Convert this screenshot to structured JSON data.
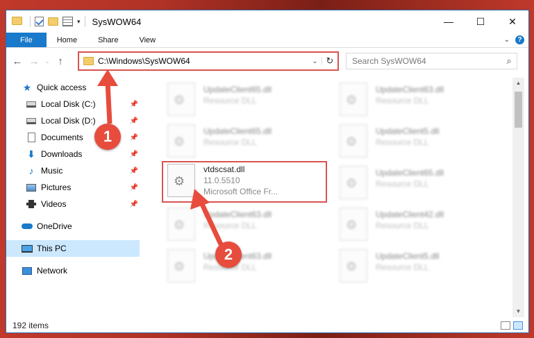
{
  "window": {
    "title": "SysWOW64",
    "controls": {
      "minimize": "—",
      "maximize": "☐",
      "close": "✕"
    }
  },
  "ribbon": {
    "tabs": [
      "File",
      "Home",
      "Share",
      "View"
    ],
    "help": "?"
  },
  "nav": {
    "back": "←",
    "forward": "→",
    "recent": "⌄",
    "up": "↑"
  },
  "address": {
    "path": "C:\\Windows\\SysWOW64",
    "dropdown": "⌄",
    "refresh": "↻"
  },
  "search": {
    "placeholder": "Search SysWOW64",
    "icon": "⌕"
  },
  "sidebar": {
    "items": [
      {
        "label": "Quick access",
        "icon": "star-icon",
        "pinned": false
      },
      {
        "label": "Local Disk (C:)",
        "icon": "disk-icon",
        "pinned": true
      },
      {
        "label": "Local Disk (D:)",
        "icon": "disk-icon",
        "pinned": true
      },
      {
        "label": "Documents",
        "icon": "documents-icon",
        "pinned": true
      },
      {
        "label": "Downloads",
        "icon": "download-icon",
        "pinned": true
      },
      {
        "label": "Music",
        "icon": "music-icon",
        "pinned": true
      },
      {
        "label": "Pictures",
        "icon": "pictures-icon",
        "pinned": true
      },
      {
        "label": "Videos",
        "icon": "videos-icon",
        "pinned": true
      },
      {
        "label": "OneDrive",
        "icon": "onedrive-icon",
        "pinned": false
      },
      {
        "label": "This PC",
        "icon": "this-pc-icon",
        "pinned": false
      },
      {
        "label": "Network",
        "icon": "network-icon",
        "pinned": false
      }
    ],
    "pin_glyph": "📌"
  },
  "files": [
    {
      "name": "UpdateClient65.dll",
      "line2": "Resource DLL",
      "col": 0,
      "row": 0
    },
    {
      "name": "UpdateClient63.dll",
      "line2": "Resource DLL",
      "col": 1,
      "row": 0
    },
    {
      "name": "UpdateClient65.dll",
      "line2": "Resource DLL",
      "col": 0,
      "row": 1
    },
    {
      "name": "UpdateClient5.dll",
      "line2": "Resource DLL",
      "col": 1,
      "row": 1
    },
    {
      "name": "vtdscsat.dll",
      "line2": "11.0.5510",
      "line3": "Microsoft Office Fr...",
      "col": 0,
      "row": 2,
      "highlighted": true
    },
    {
      "name": "UpdateClient65.dll",
      "line2": "Resource DLL",
      "col": 1,
      "row": 2
    },
    {
      "name": "UpdateClient63.dll",
      "line2": "Resource DLL",
      "col": 0,
      "row": 3
    },
    {
      "name": "UpdateClient42.dll",
      "line2": "Resource DLL",
      "col": 1,
      "row": 3
    },
    {
      "name": "UpdateClient63.dll",
      "line2": "Resource DLL",
      "col": 0,
      "row": 4
    },
    {
      "name": "UpdateClient5.dll",
      "line2": "Resource DLL",
      "col": 1,
      "row": 4
    }
  ],
  "status": {
    "count": "192 items"
  },
  "callouts": [
    "1",
    "2"
  ],
  "colors": {
    "accent": "#1979ca",
    "highlight": "#d9534f",
    "selection": "#cce8ff",
    "callout": "#e74c3c"
  }
}
